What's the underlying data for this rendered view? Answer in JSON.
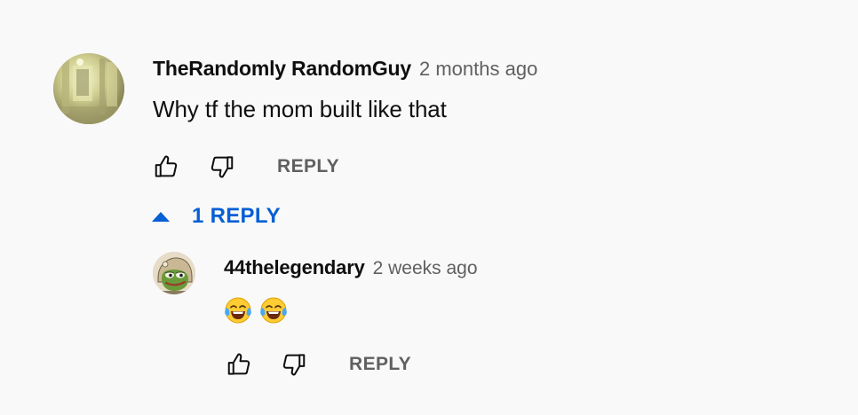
{
  "comment": {
    "author": "TheRandomly RandomGuy",
    "timestamp": "2 months ago",
    "text": "Why tf the mom built like that",
    "avatar_icon": "hallway-photo-avatar",
    "like_icon": "thumbs-up-icon",
    "dislike_icon": "thumbs-down-icon",
    "reply_label": "REPLY"
  },
  "replies_toggle": {
    "label": "1 REPLY",
    "icon": "caret-up-icon",
    "color": "#065fd4"
  },
  "reply": {
    "author": "44thelegendary",
    "timestamp": "2 weeks ago",
    "emojis": [
      "face-with-tears-of-joy",
      "face-with-tears-of-joy"
    ],
    "avatar_icon": "pepe-frog-avatar",
    "like_icon": "thumbs-up-icon",
    "dislike_icon": "thumbs-down-icon",
    "reply_label": "REPLY"
  },
  "colors": {
    "background": "#f9f9f9",
    "text_primary": "#0f0f0f",
    "text_secondary": "#606060",
    "link_blue": "#065fd4"
  }
}
